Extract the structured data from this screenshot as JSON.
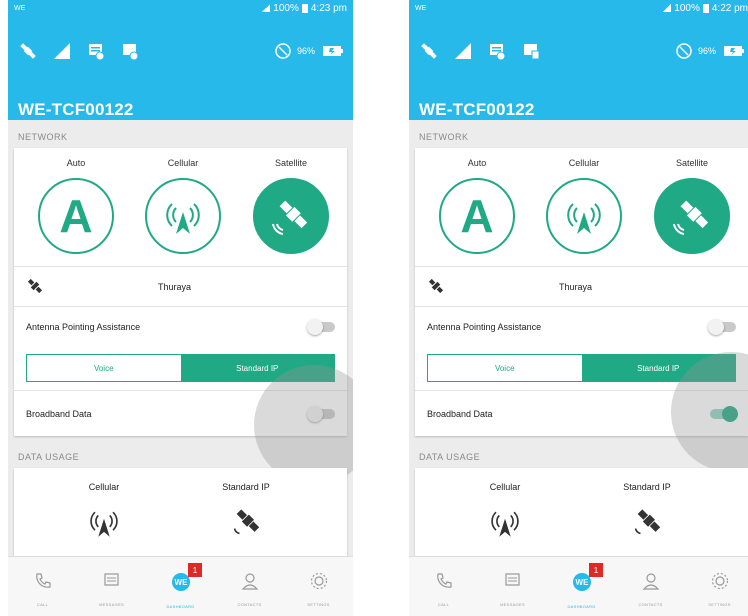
{
  "screens": [
    {
      "status": {
        "carrier": "WE",
        "battery": "100%",
        "time": "4:23 pm"
      },
      "header": {
        "battery_pct": "96%",
        "title": "WE-TCF00122"
      },
      "network": {
        "section": "NETWORK",
        "modes": [
          "Auto",
          "Cellular",
          "Satellite"
        ],
        "active_mode": "Satellite",
        "provider": "Thuraya",
        "antenna_label": "Antenna Pointing Assistance",
        "antenna_on": false,
        "seg_voice": "Voice",
        "seg_ip": "Standard IP",
        "seg_active": "Standard IP",
        "broadband_label": "Broadband Data",
        "broadband_on": false
      },
      "usage": {
        "section": "DATA USAGE",
        "col1": "Cellular",
        "col2": "Standard IP"
      },
      "nav": {
        "items": [
          "CALL",
          "MESSAGES",
          "DASHBOARD",
          "CONTACTS",
          "SETTINGS"
        ],
        "active": "DASHBOARD",
        "badge": "1"
      }
    },
    {
      "status": {
        "carrier": "WE",
        "battery": "100%",
        "time": "4:22 pm"
      },
      "header": {
        "battery_pct": "96%",
        "title": "WE-TCF00122"
      },
      "network": {
        "section": "NETWORK",
        "modes": [
          "Auto",
          "Cellular",
          "Satellite"
        ],
        "active_mode": "Satellite",
        "provider": "Thuraya",
        "antenna_label": "Antenna Pointing Assistance",
        "antenna_on": false,
        "seg_voice": "Voice",
        "seg_ip": "Standard IP",
        "seg_active": "Standard IP",
        "broadband_label": "Broadband Data",
        "broadband_on": true
      },
      "usage": {
        "section": "DATA USAGE",
        "col1": "Cellular",
        "col2": "Standard IP"
      },
      "nav": {
        "items": [
          "CALL",
          "MESSAGES",
          "DASHBOARD",
          "CONTACTS",
          "SETTINGS"
        ],
        "active": "DASHBOARD",
        "badge": "1"
      }
    }
  ],
  "colors": {
    "header": "#27b9ea",
    "accent": "#1fa985",
    "badge": "#e02828"
  }
}
